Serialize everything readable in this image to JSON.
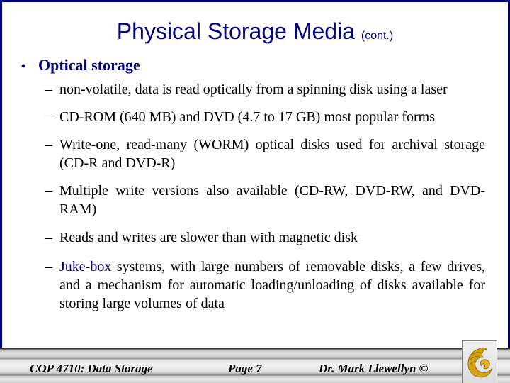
{
  "slide": {
    "title": "Physical Storage Media",
    "title_suffix": "(cont.)",
    "bullet": {
      "marker": "•",
      "label": "Optical storage"
    },
    "sub_marker": "–",
    "sub_bullets": [
      {
        "text": "non-volatile, data is read optically from a spinning disk using a laser"
      },
      {
        "text": "CD-ROM (640 MB) and DVD (4.7 to 17 GB) most popular forms"
      },
      {
        "text": "Write-one, read-many (WORM) optical disks used for archival storage (CD-R and DVD-R)"
      },
      {
        "text": "Multiple write versions also available (CD-RW, DVD-RW, and DVD-RAM)"
      },
      {
        "text": "Reads and writes are slower than with magnetic disk"
      },
      {
        "highlight": "Juke-box",
        "text": " systems, with large numbers of removable disks, a few drives, and a mechanism for automatic loading/unloading of disks available for storing large volumes of data"
      }
    ]
  },
  "footer": {
    "course": "COP 4710: Data Storage",
    "page": "Page 7",
    "author": "Dr. Mark Llewellyn ©",
    "logo_icon": "ucf-pegasus-logo"
  },
  "colors": {
    "accent": "#000080",
    "logo_gold": "#d4a017"
  }
}
